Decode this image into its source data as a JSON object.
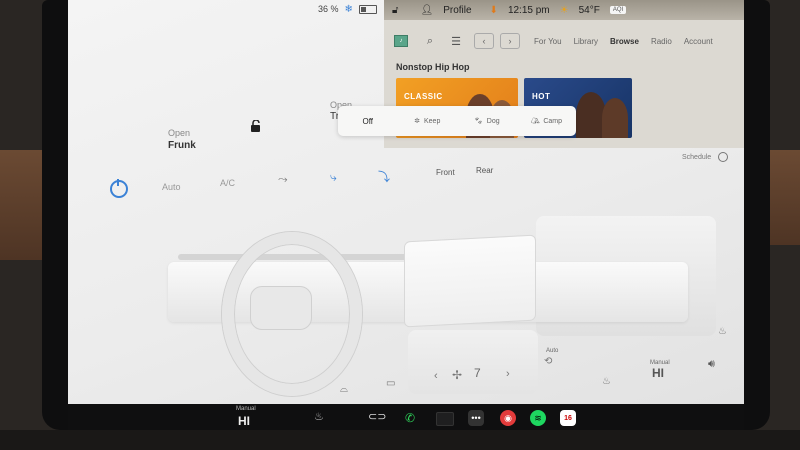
{
  "status": {
    "battery_percent": "36 %",
    "snow_icon": "snowflake-icon",
    "profile_label": "Profile",
    "time": "12:15 pm",
    "temperature": "54°F",
    "air_quality": "AQI"
  },
  "media": {
    "tabs": [
      "For You",
      "Library",
      "Browse",
      "Radio",
      "Account"
    ],
    "active_tab": "Browse",
    "section_title": "Nonstop Hip Hop",
    "albums": [
      {
        "title": "CLASSIC"
      },
      {
        "title": "HOT"
      }
    ]
  },
  "controls": {
    "frunk_state": "Open",
    "frunk_label": "Frunk",
    "trunk_state": "Open",
    "trunk_label": "Tr"
  },
  "popup": {
    "options": [
      "Off",
      "Keep",
      "Dog",
      "Camp"
    ],
    "selected": "Off"
  },
  "climate": {
    "auto_label": "Auto",
    "ac_label": "A/C",
    "tabs": [
      "Front",
      "Rear"
    ],
    "schedule_label": "Schedule",
    "fan_speed": "7",
    "auto_small": "Auto"
  },
  "dock": {
    "left_mode": "Manual",
    "left_temp": "HI",
    "right_mode": "Manual",
    "right_temp": "HI",
    "calendar_day": "16"
  },
  "colors": {
    "accent_blue": "#3b82d6",
    "spotify_green": "#1ed760",
    "phone_green": "#2fd45b"
  }
}
